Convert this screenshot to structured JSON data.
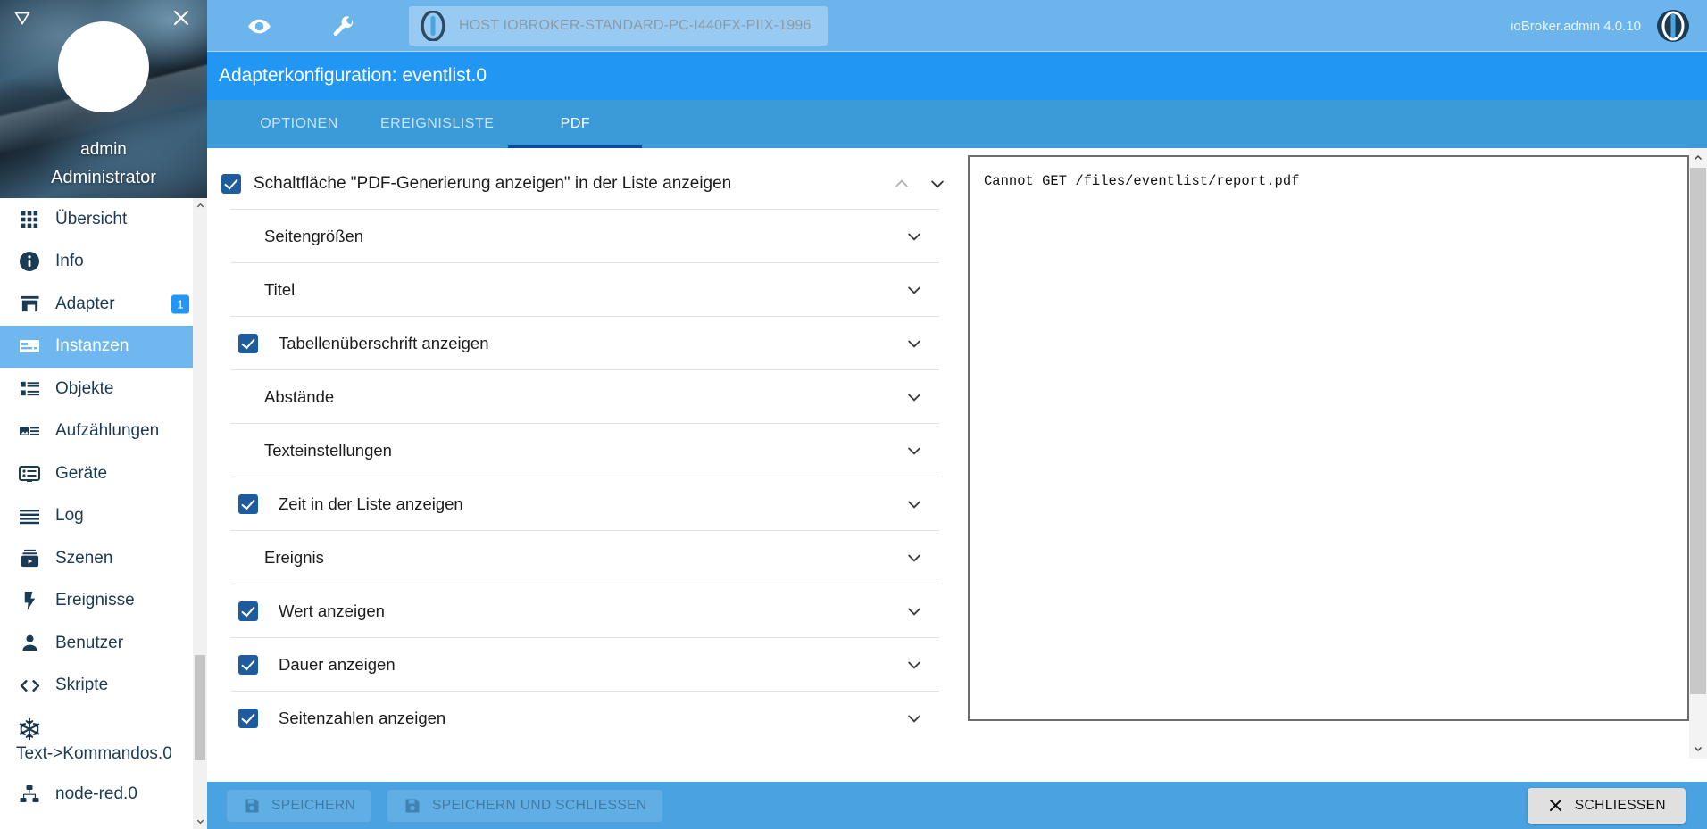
{
  "sidebar": {
    "collapse_icon": "collapse-triangle-icon",
    "close_icon": "close-icon",
    "user": {
      "name": "admin",
      "role": "Administrator"
    },
    "items": [
      {
        "label": "Übersicht",
        "icon": "grid-icon",
        "active": false
      },
      {
        "label": "Info",
        "icon": "info-icon",
        "active": false
      },
      {
        "label": "Adapter",
        "icon": "store-icon",
        "active": false,
        "badge": "1"
      },
      {
        "label": "Instanzen",
        "icon": "instances-icon",
        "active": true
      },
      {
        "label": "Objekte",
        "icon": "list-icon",
        "active": false
      },
      {
        "label": "Aufzählungen",
        "icon": "enums-icon",
        "active": false
      },
      {
        "label": "Geräte",
        "icon": "devices-icon",
        "active": false
      },
      {
        "label": "Log",
        "icon": "log-lines-icon",
        "active": false
      },
      {
        "label": "Szenen",
        "icon": "scenes-play-icon",
        "active": false
      },
      {
        "label": "Ereignisse",
        "icon": "lightning-icon",
        "active": false
      },
      {
        "label": "Benutzer",
        "icon": "user-icon",
        "active": false
      },
      {
        "label": "Skripte",
        "icon": "code-brackets-icon",
        "active": false
      },
      {
        "label": "Text->Kommandos.0",
        "icon": "snowflake-icon",
        "active": false,
        "tall": true
      },
      {
        "label": "node-red.0",
        "icon": "node-red-icon",
        "active": false
      }
    ]
  },
  "topbar": {
    "eye_icon": "eye-icon",
    "wrench_icon": "wrench-icon",
    "host_label": "HOST IOBROKER-STANDARD-PC-I440FX-PIIX-1996",
    "host_logo_icon": "iobroker-logo-icon",
    "version": "ioBroker.admin 4.0.10",
    "app_logo_icon": "iobroker-logo-icon"
  },
  "dialog": {
    "title": "Adapterkonfiguration: eventlist.0",
    "tabs": [
      {
        "label": "OPTIONEN",
        "active": false
      },
      {
        "label": "EREIGNISLISTE",
        "active": false
      },
      {
        "label": "PDF",
        "active": true
      }
    ],
    "header_setting": {
      "label": "Schaltfläche \"PDF-Generierung anzeigen\" in der Liste anzeigen",
      "checked": true,
      "collapse_up_icon": "chevron-up-icon",
      "collapse_down_icon": "chevron-down-icon"
    },
    "settings": [
      {
        "label": "Seitengrößen",
        "checkbox": false,
        "checked": false,
        "expand_icon": "chevron-down-icon"
      },
      {
        "label": "Titel",
        "checkbox": false,
        "checked": false,
        "expand_icon": "chevron-down-icon"
      },
      {
        "label": "Tabellenüberschrift anzeigen",
        "checkbox": true,
        "checked": true,
        "expand_icon": "chevron-down-icon"
      },
      {
        "label": "Abstände",
        "checkbox": false,
        "checked": false,
        "expand_icon": "chevron-down-icon"
      },
      {
        "label": "Texteinstellungen",
        "checkbox": false,
        "checked": false,
        "expand_icon": "chevron-down-icon"
      },
      {
        "label": "Zeit in der Liste anzeigen",
        "checkbox": true,
        "checked": true,
        "expand_icon": "chevron-down-icon"
      },
      {
        "label": "Ereignis",
        "checkbox": false,
        "checked": false,
        "expand_icon": "chevron-down-icon"
      },
      {
        "label": "Wert anzeigen",
        "checkbox": true,
        "checked": true,
        "expand_icon": "chevron-down-icon"
      },
      {
        "label": "Dauer anzeigen",
        "checkbox": true,
        "checked": true,
        "expand_icon": "chevron-down-icon"
      },
      {
        "label": "Seitenzahlen anzeigen",
        "checkbox": true,
        "checked": true,
        "expand_icon": "chevron-down-icon"
      }
    ],
    "preview": {
      "text": "Cannot GET /files/eventlist/report.pdf"
    },
    "footer": {
      "save_label": "SPEICHERN",
      "save_icon": "save-disk-icon",
      "save_close_label": "SPEICHERN UND SCHLIESSEN",
      "save_close_icon": "save-disk-icon",
      "close_label": "SCHLIESSEN",
      "close_icon": "close-x-icon"
    }
  },
  "scrollbars": {
    "up_arrow_icon": "chevron-up-icon",
    "down_arrow_icon": "chevron-down-icon"
  },
  "colors": {
    "accent": "#2196f3",
    "topbar": "#6cb4ec",
    "dialog_bg": "#4aa3e0",
    "tabs_bg": "#3b9ad8",
    "sidebar_active": "#6fb8ef",
    "checkbox": "#1f5c9e",
    "sidebar_text": "#1b3a54"
  }
}
